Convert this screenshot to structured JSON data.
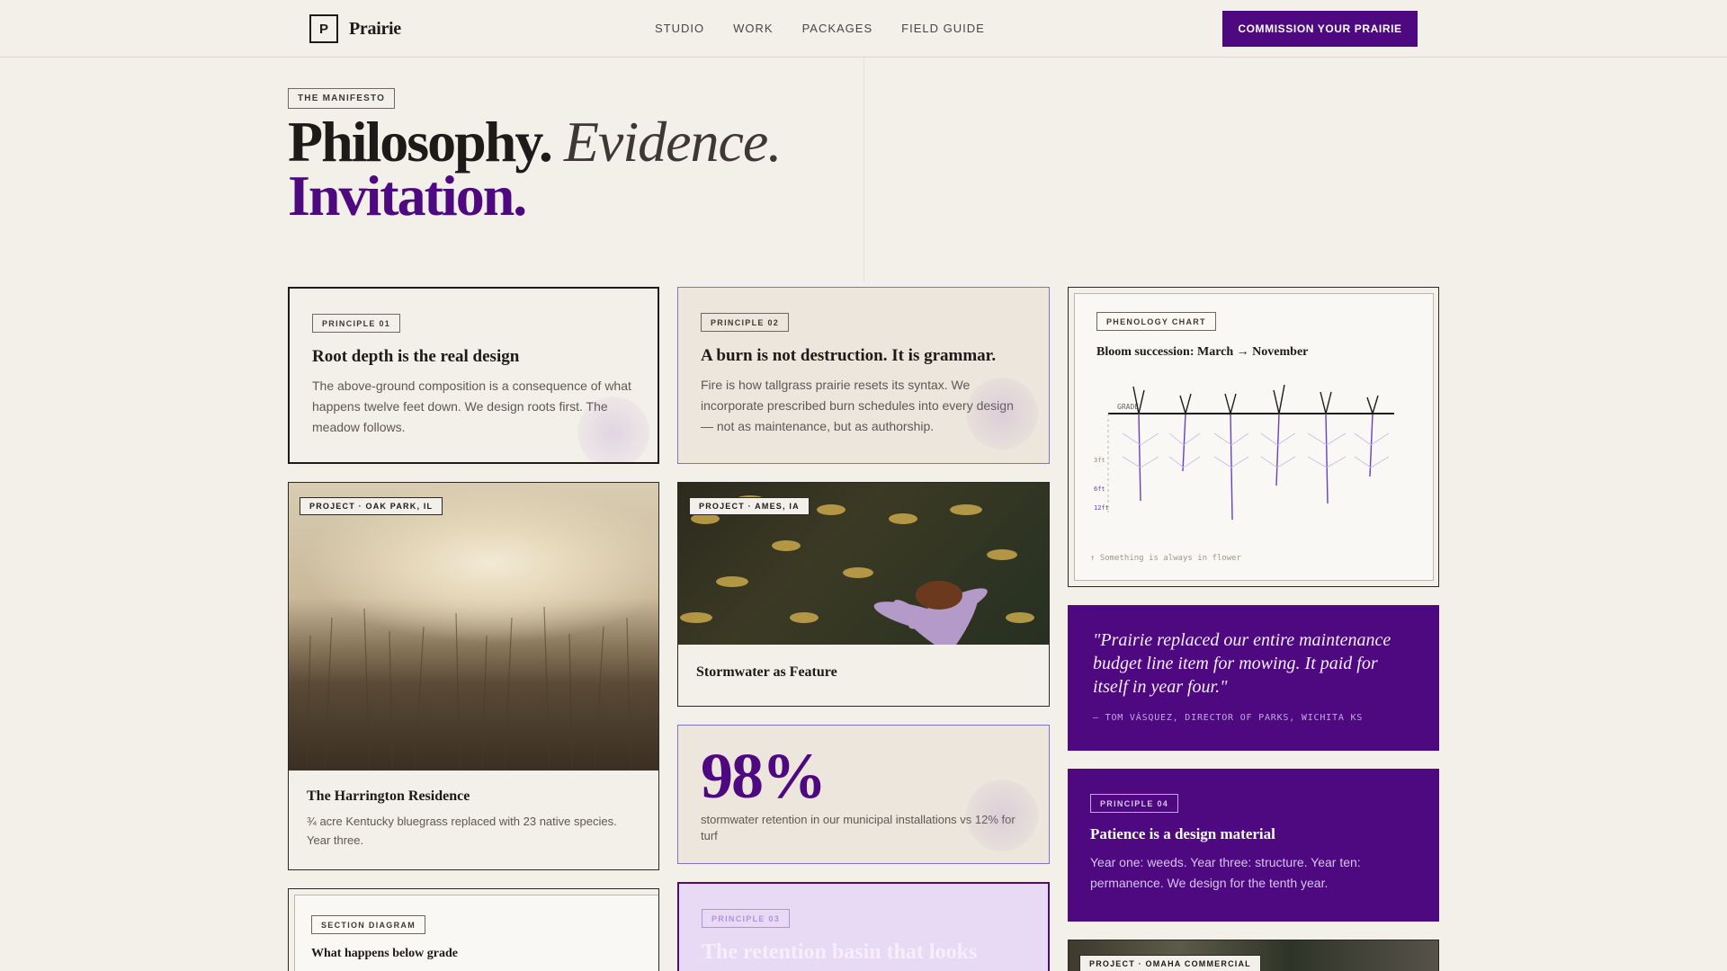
{
  "brand": {
    "mark": "P",
    "name": "Prairie"
  },
  "nav": {
    "links": [
      "STUDIO",
      "WORK",
      "PACKAGES",
      "FIELD GUIDE"
    ],
    "cta": "COMMISSION YOUR PRAIRIE"
  },
  "hero": {
    "eyebrow": "THE MANIFESTO",
    "word1": "Philosophy.",
    "word2": "Evidence.",
    "word3": "Invitation."
  },
  "principle1": {
    "tag": "PRINCIPLE 01",
    "title": "Root depth is the real design",
    "body": "The above-ground composition is a consequence of what happens twelve feet down. We design roots first. The meadow follows."
  },
  "principle2": {
    "tag": "PRINCIPLE 02",
    "title": "A burn is not destruction. It is grammar.",
    "body": "Fire is how tallgrass prairie resets its syntax. We incorporate prescribed burn schedules into every design — not as maintenance, but as authorship."
  },
  "chart": {
    "tag": "PHENOLOGY CHART",
    "title": "Bloom succession: March → November",
    "grade_label": "GRADE",
    "depth_labels": [
      "3ft",
      "6ft",
      "12ft"
    ],
    "footnote": "↑ Something is always in flower",
    "accent": "#6a3fc0"
  },
  "project_oak": {
    "tag": "PROJECT · OAK PARK, IL",
    "title": "The Harrington Residence",
    "body": "¾ acre Kentucky bluegrass replaced with 23 native species. Year three."
  },
  "project_ames": {
    "tag": "PROJECT · AMES, IA",
    "title": "Stormwater as Feature"
  },
  "stat": {
    "value": "98%",
    "caption": "stormwater retention in our municipal installations vs 12% for turf"
  },
  "quote": {
    "text": "\"Prairie replaced our entire maintenance budget line item for mowing. It paid for itself in year four.\"",
    "attribution": "— TOM VÁSQUEZ, DIRECTOR OF PARKS, WICHITA KS"
  },
  "principle4": {
    "tag": "PRINCIPLE 04",
    "title": "Patience is a design material",
    "body": "Year one: weeds. Year three: structure. Year ten: permanence. We design for the tenth year."
  },
  "diagram": {
    "tag": "SECTION DIAGRAM",
    "title": "What happens below grade"
  },
  "principle3": {
    "tag": "PRINCIPLE 03",
    "title": "The retention basin that looks"
  },
  "project_omaha": {
    "tag": "PROJECT · OMAHA COMMERCIAL"
  },
  "colors": {
    "accent": "#4e0880",
    "background": "#f3efe9"
  }
}
